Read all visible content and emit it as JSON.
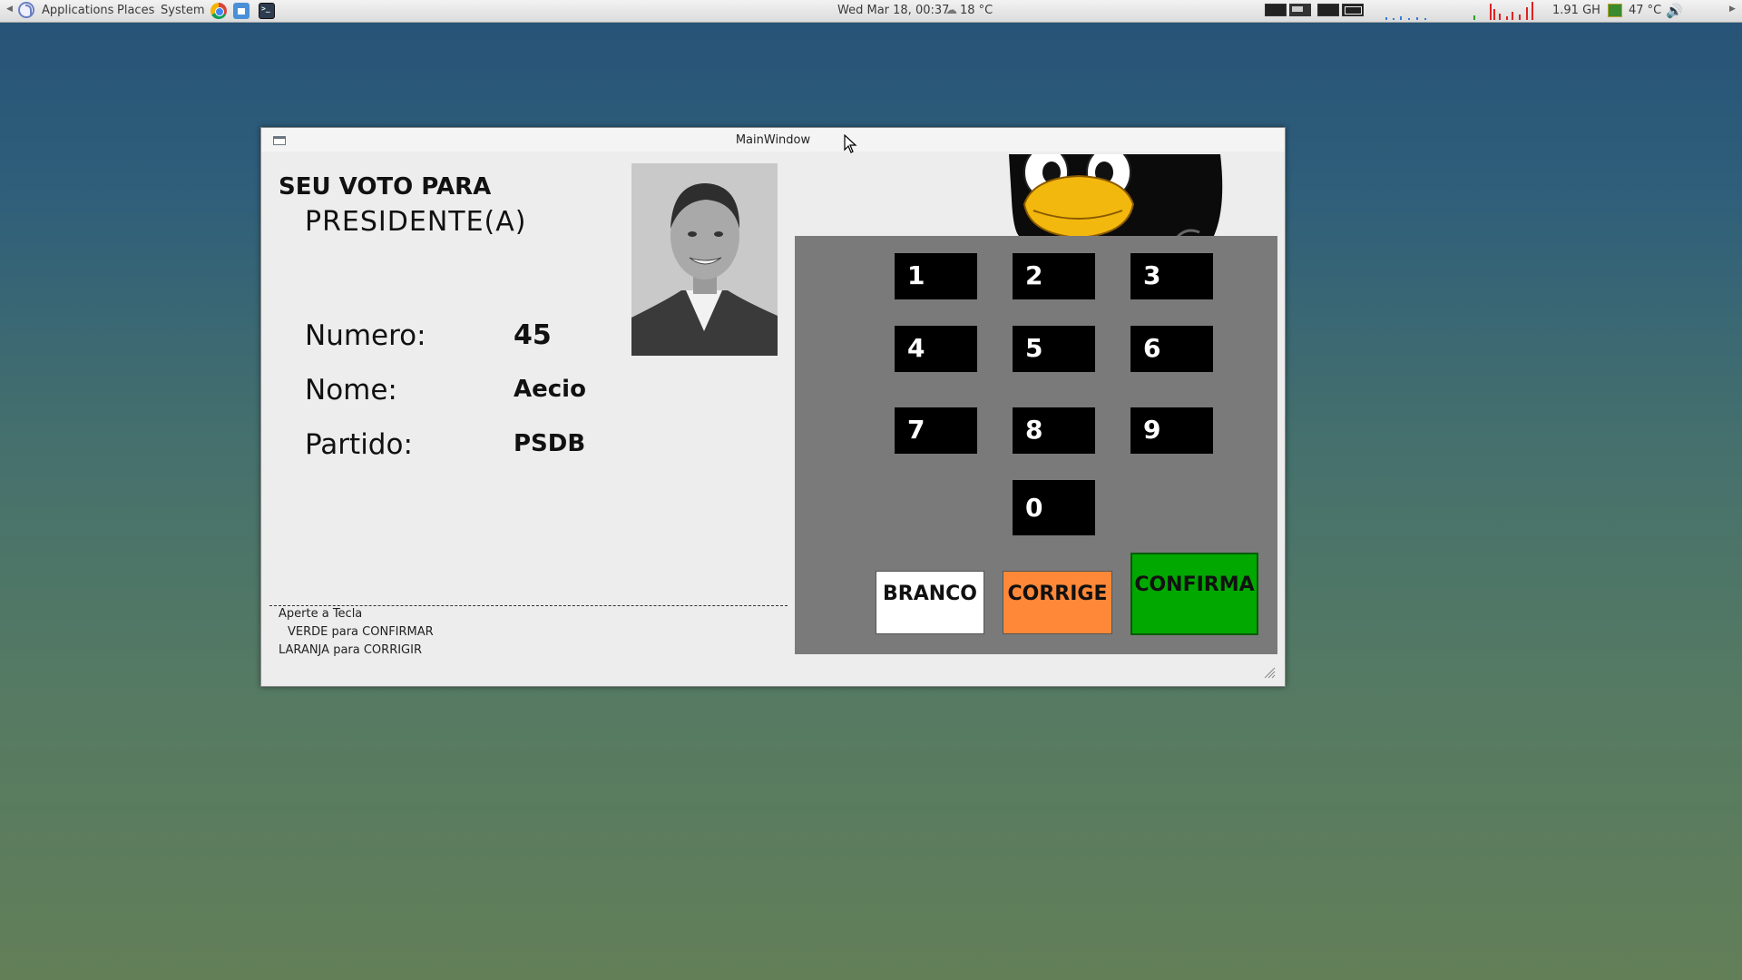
{
  "panel": {
    "menus": [
      "Applications",
      "Places",
      "System"
    ],
    "clock": "Wed Mar 18, 00:37",
    "weather": "18 °C",
    "cpu_freq": "1.91 GH",
    "temperature": "47 °C",
    "icons": [
      "fedora-logo-icon",
      "chrome-icon",
      "home-folder-icon",
      "terminal-icon",
      "chip-icon",
      "speaker-icon"
    ]
  },
  "window": {
    "title": "MainWindow"
  },
  "ballot": {
    "heading": "SEU VOTO PARA",
    "office": "PRESIDENTE(A)",
    "fields": [
      {
        "label": "Numero:",
        "value": "45"
      },
      {
        "label": "Nome:",
        "value": "Aecio"
      },
      {
        "label": "Partido:",
        "value": "PSDB"
      }
    ],
    "instructions": [
      "Aperte a Tecla",
      "VERDE para CONFIRMAR",
      "LARANJA para CORRIGIR"
    ]
  },
  "keypad": {
    "digits": [
      "1",
      "2",
      "3",
      "4",
      "5",
      "6",
      "7",
      "8",
      "9",
      "0"
    ],
    "branco": "BRANCO",
    "corrige": "CORRIGE",
    "confirma": "CONFIRMA"
  },
  "colors": {
    "branco": "#ffffff",
    "corrige": "#ff8838",
    "confirma": "#00a800",
    "keypad_bg": "#7a7a7a",
    "key_bg": "#000000"
  }
}
